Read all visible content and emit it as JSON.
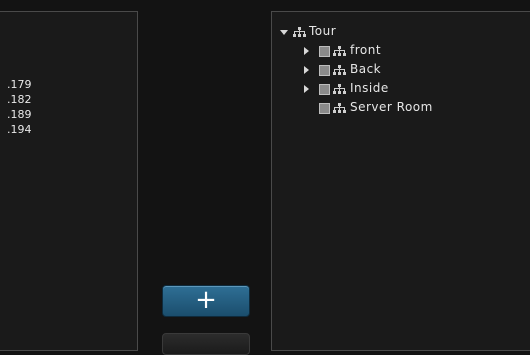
{
  "left_panel": {
    "ip_values": [
      ".179",
      ".182",
      ".189",
      ".194"
    ]
  },
  "add_button": {
    "label": "+",
    "icon": "plus-icon"
  },
  "tree": {
    "root": {
      "label": "Tour",
      "icon": "network-icon",
      "expanded": true
    },
    "children": [
      {
        "label": "front",
        "icon": "network-icon",
        "expandable": true,
        "checked": false
      },
      {
        "label": "Back",
        "icon": "network-icon",
        "expandable": true,
        "checked": false
      },
      {
        "label": "Inside",
        "icon": "network-icon",
        "expandable": true,
        "checked": false
      },
      {
        "label": "Server Room",
        "icon": "network-icon",
        "expandable": false,
        "checked": false
      }
    ]
  },
  "colors": {
    "background": "#131313",
    "panel": "#1a1a1a",
    "border": "#4a4a4a",
    "button_accent": "#2f6f95"
  }
}
